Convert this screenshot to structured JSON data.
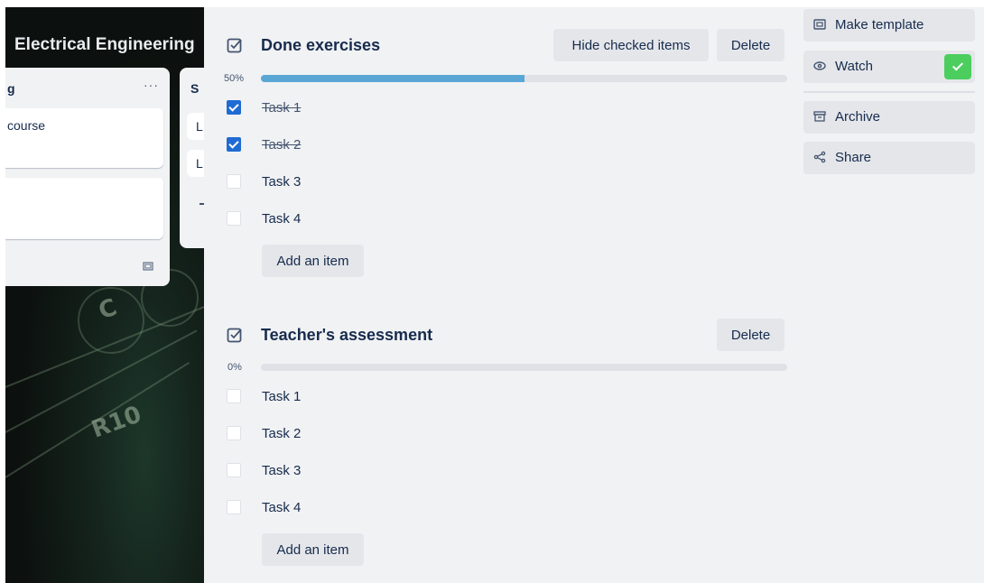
{
  "board": {
    "title": "Electrical Engineering",
    "list1": {
      "header": "g",
      "menu": "···",
      "card1_text": "course",
      "footer_icon": "template-icon"
    },
    "list2": {
      "header": "S",
      "cards": [
        "L",
        "L"
      ]
    },
    "background_labels": [
      "C",
      "R10"
    ]
  },
  "checklists": [
    {
      "title": "Done exercises",
      "percent_label": "50%",
      "progress": 0.5,
      "hide_label": "Hide checked items",
      "delete_label": "Delete",
      "items": [
        {
          "text": "Task 1",
          "checked": true
        },
        {
          "text": "Task 2",
          "checked": true
        },
        {
          "text": "Task 3",
          "checked": false
        },
        {
          "text": "Task 4",
          "checked": false
        }
      ],
      "add_label": "Add an item"
    },
    {
      "title": "Teacher's assessment",
      "percent_label": "0%",
      "progress": 0,
      "delete_label": "Delete",
      "items": [
        {
          "text": "Task 1",
          "checked": false
        },
        {
          "text": "Task 2",
          "checked": false
        },
        {
          "text": "Task 3",
          "checked": false
        },
        {
          "text": "Task 4",
          "checked": false
        }
      ],
      "add_label": "Add an item"
    }
  ],
  "sidebar": {
    "make_template": "Make template",
    "watch": "Watch",
    "watch_active": true,
    "archive": "Archive",
    "share": "Share"
  },
  "colors": {
    "progress_fill": "#5aa7d6",
    "checkbox_checked": "#1f6bd3",
    "watch_active": "#4bce5e"
  }
}
